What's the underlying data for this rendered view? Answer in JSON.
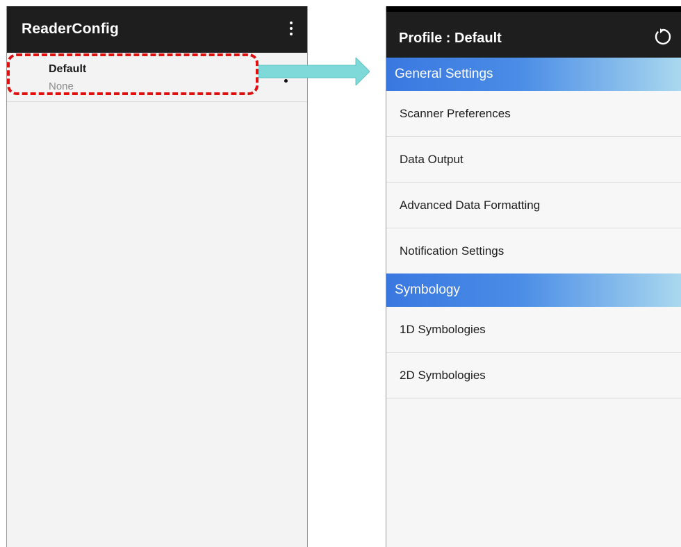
{
  "left_screen": {
    "app_title": "ReaderConfig",
    "overflow_icon": "more-vert-icon",
    "profiles": [
      {
        "name": "Default",
        "subtitle": "None"
      }
    ],
    "row_menu_icon": "more-vert-icon"
  },
  "annotation": {
    "highlight_color": "#e01010",
    "arrow_color": "#7fd9d9"
  },
  "right_screen": {
    "title": "Profile : Default",
    "reset_icon": "reset-icon",
    "sections": [
      {
        "header": "General Settings",
        "items": [
          "Scanner Preferences",
          "Data Output",
          "Advanced Data Formatting",
          "Notification Settings"
        ]
      },
      {
        "header": "Symbology",
        "items": [
          "1D Symbologies",
          "2D Symbologies"
        ]
      }
    ],
    "section_header_color": "#3a78e0"
  }
}
